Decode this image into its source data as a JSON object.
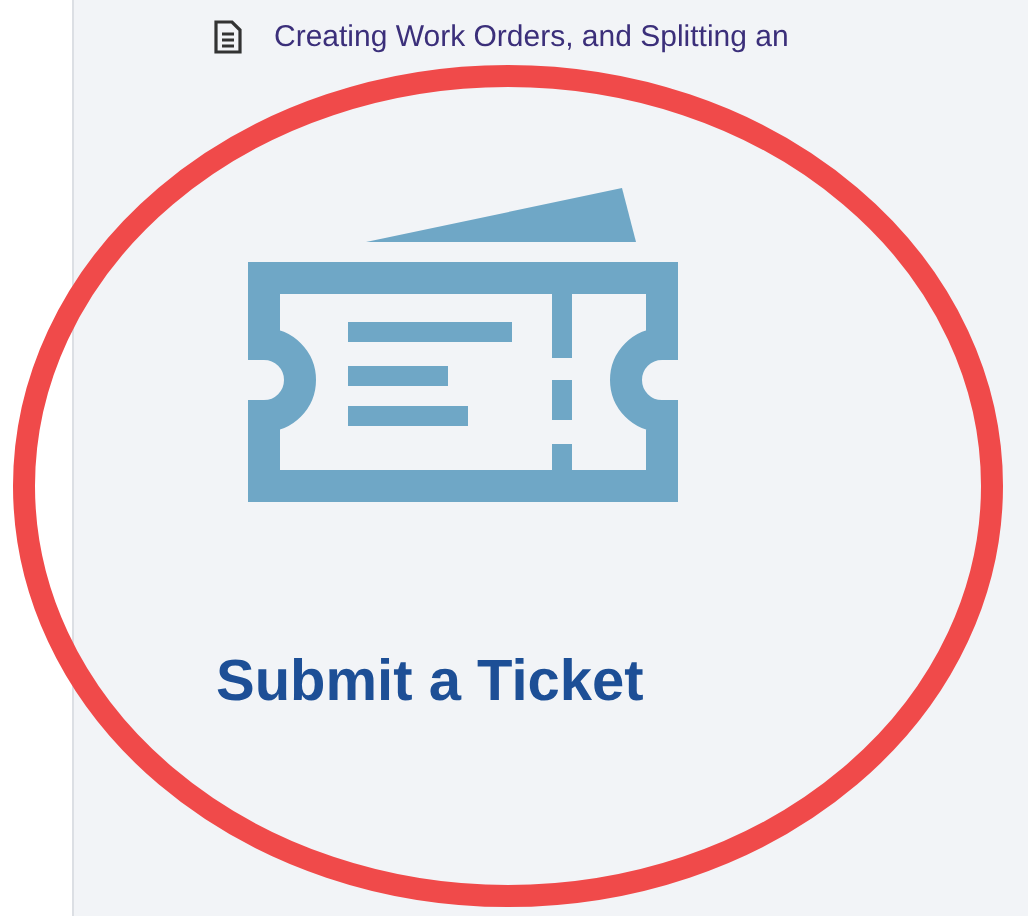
{
  "links": [
    {
      "kind": "document",
      "label": "Creating Work Orders, and Splitting an"
    }
  ],
  "card": {
    "title": "Submit a Ticket"
  },
  "highlight": {
    "kind": "circle"
  }
}
